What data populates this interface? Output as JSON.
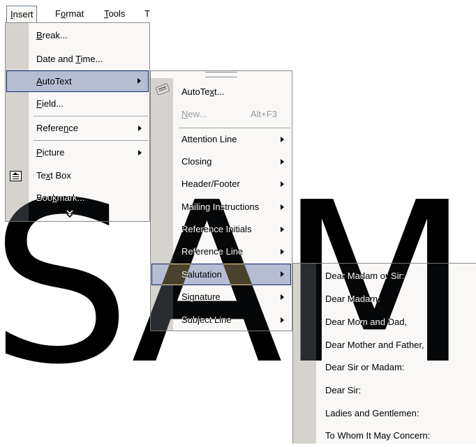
{
  "menubar": {
    "items": [
      {
        "label_pre": "",
        "mnemonic": "I",
        "label_post": "nsert"
      },
      {
        "label_pre": "F",
        "mnemonic": "o",
        "label_post": "rmat"
      },
      {
        "label_pre": "",
        "mnemonic": "T",
        "label_post": "ools"
      },
      {
        "label_pre": "",
        "mnemonic": "",
        "label_post": "T"
      }
    ]
  },
  "insert_menu": {
    "items": [
      {
        "pre": "",
        "mn": "B",
        "post": "reak..."
      },
      {
        "pre": "Date and ",
        "mn": "T",
        "post": "ime..."
      },
      {
        "pre": "",
        "mn": "A",
        "post": "utoText"
      },
      {
        "pre": "",
        "mn": "F",
        "post": "ield..."
      },
      {
        "pre": "Refere",
        "mn": "n",
        "post": "ce"
      },
      {
        "pre": "",
        "mn": "P",
        "post": "icture"
      },
      {
        "pre": "Te",
        "mn": "x",
        "post": "t Box"
      },
      {
        "pre": "Boo",
        "mn": "k",
        "post": "mark..."
      }
    ],
    "expand_glyph": "¥"
  },
  "autotext_menu": {
    "items": [
      {
        "pre": "AutoTe",
        "mn": "x",
        "post": "t..."
      },
      {
        "pre": "",
        "mn": "N",
        "post": "ew...",
        "shortcut": "Alt+F3"
      },
      {
        "label": "Attention Line"
      },
      {
        "label": "Closing"
      },
      {
        "label": "Header/Footer"
      },
      {
        "label": "Mailing Instructions"
      },
      {
        "label": "Reference Initials"
      },
      {
        "label": "Reference Line"
      },
      {
        "label": "Salutation"
      },
      {
        "label": "Signature"
      },
      {
        "label": "Subject Line"
      }
    ]
  },
  "salutation_menu": {
    "items": [
      "Dear Madam or Sir:",
      "Dear Madam:",
      "Dear Mom and Dad,",
      "Dear Mother and Father,",
      "Dear Sir or Madam:",
      "Dear Sir:",
      "Ladies and Gentlemen:",
      "To Whom It May Concern:"
    ]
  },
  "watermark": {
    "text": "SAMPLE"
  },
  "colors": {
    "highlight": "#b6bdd2",
    "highlight_border": "#0a246a",
    "gutter": "#d6d3ce",
    "menu_bg": "#f9f8f7"
  }
}
